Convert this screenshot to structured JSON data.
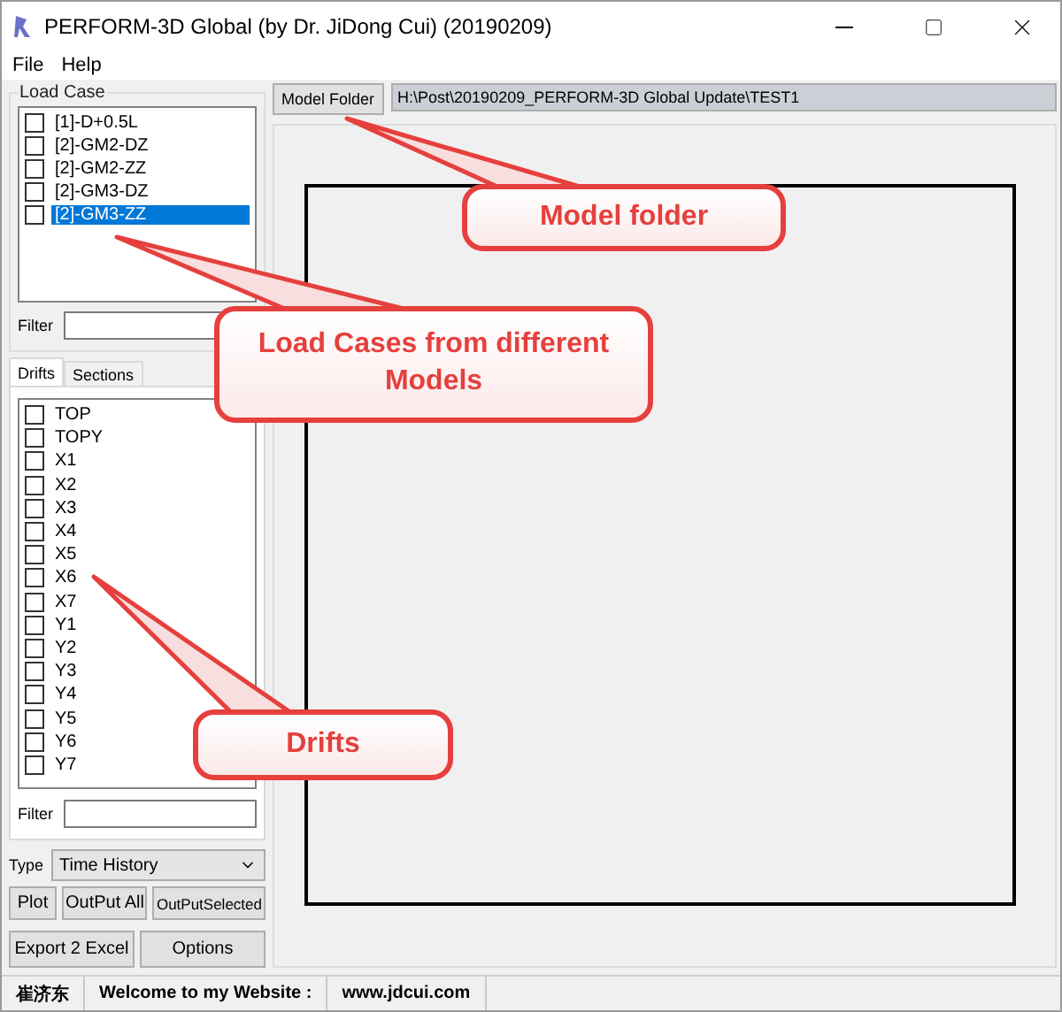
{
  "window": {
    "title": "PERFORM-3D Global (by Dr. JiDong Cui) (20190209)"
  },
  "menu": [
    "File",
    "Help"
  ],
  "load_case": {
    "label": "Load Case",
    "filter_label": "Filter",
    "items": [
      {
        "label": "[1]-D+0.5L",
        "checked": false,
        "selected": false
      },
      {
        "label": "[2]-GM2-DZ",
        "checked": false,
        "selected": false
      },
      {
        "label": "[2]-GM2-ZZ",
        "checked": false,
        "selected": false
      },
      {
        "label": "[2]-GM3-DZ",
        "checked": false,
        "selected": false
      },
      {
        "label": "[2]-GM3-ZZ",
        "checked": false,
        "selected": true
      }
    ]
  },
  "tabs": [
    {
      "label": "Drifts",
      "selected": true
    },
    {
      "label": "Sections",
      "selected": false
    }
  ],
  "drifts": {
    "filter_label": "Filter",
    "items": [
      {
        "label": "TOP",
        "checked": false
      },
      {
        "label": "TOPY",
        "checked": false
      },
      {
        "label": "X1",
        "checked": false
      },
      {
        "label": "X2",
        "checked": false
      },
      {
        "label": "X3",
        "checked": false
      },
      {
        "label": "X4",
        "checked": false
      },
      {
        "label": "X5",
        "checked": false
      },
      {
        "label": "X6",
        "checked": false
      },
      {
        "label": "X7",
        "checked": false
      },
      {
        "label": "Y1",
        "checked": false
      },
      {
        "label": "Y2",
        "checked": false
      },
      {
        "label": "Y3",
        "checked": false
      },
      {
        "label": "Y4",
        "checked": false
      },
      {
        "label": "Y5",
        "checked": false
      },
      {
        "label": "Y6",
        "checked": false
      },
      {
        "label": "Y7",
        "checked": false
      }
    ]
  },
  "type": {
    "label": "Type",
    "value": "Time History"
  },
  "buttons": [
    "Plot",
    "OutPut All",
    "OutPutSelected",
    "Export 2 Excel",
    "Options"
  ],
  "model_folder": {
    "button": "Model Folder",
    "path": "H:\\Post\\20190209_PERFORM-3D Global Update\\TEST1"
  },
  "callouts": [
    {
      "text": "Model folder"
    },
    {
      "text": "Load Cases from different Models"
    },
    {
      "text": "Drifts"
    }
  ],
  "status_bar": [
    "崔济东",
    "Welcome to my Website :",
    "www.jdcui.com"
  ]
}
